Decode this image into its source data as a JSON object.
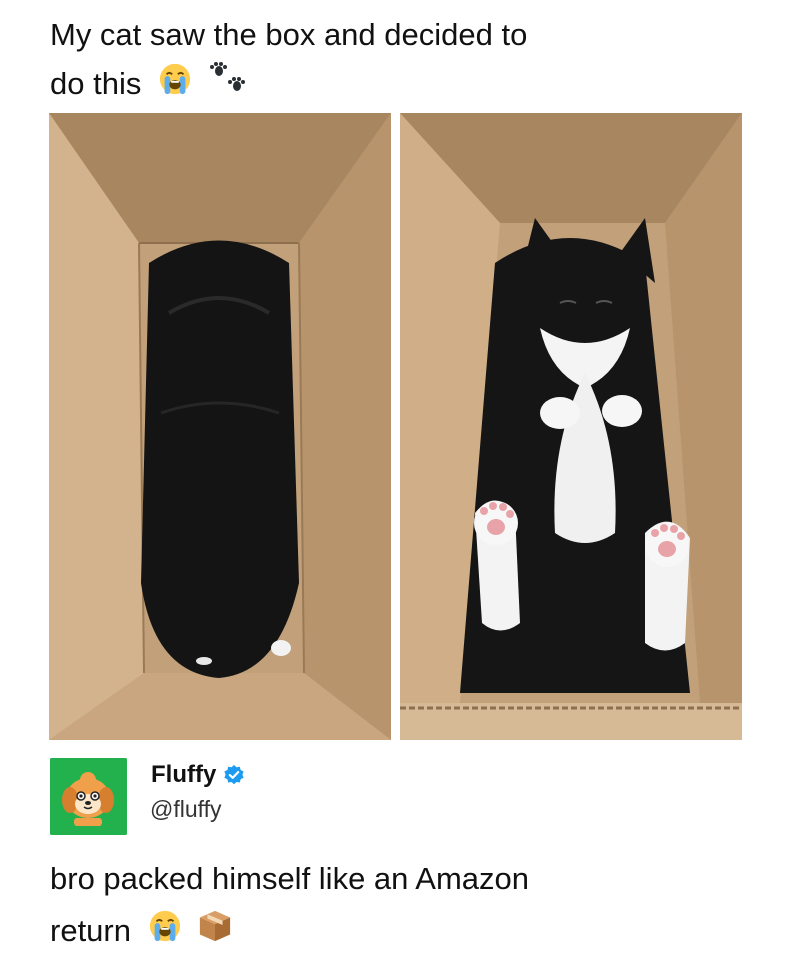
{
  "post": {
    "caption_line1": "My cat saw the box and decided to",
    "caption_line2": "do this",
    "caption_emojis": [
      "loudly-crying-face-icon",
      "paw-prints-icon"
    ]
  },
  "photos": [
    {
      "name": "cat-in-box-top-view"
    },
    {
      "name": "cat-in-box-belly-up"
    }
  ],
  "reply": {
    "display_name": "Fluffy",
    "handle": "@fluffy",
    "verified": true,
    "avatar_icon": "dog-cartoon-icon",
    "avatar_color": "#22b14c",
    "text_line1": "bro packed himself like an Amazon",
    "text_line2": "return",
    "text_emojis": [
      "loudly-crying-face-icon",
      "package-icon"
    ]
  },
  "colors": {
    "cardboard": "#c9a57e",
    "verified_blue": "#1d9bf0"
  }
}
